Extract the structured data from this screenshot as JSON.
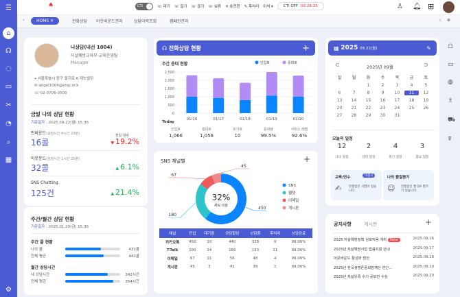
{
  "topbar": {
    "cti_toggle": "CTI",
    "actions": [
      "대기",
      "걸기",
      "끊기",
      "보류",
      "호전환",
      "후처리"
    ],
    "dropdown": "이석",
    "cti_status": "CTI OFF",
    "timer": "00:28:35"
  },
  "tabs": [
    "HOME",
    "전화상담",
    "아웃바운드관리",
    "상담이력조회",
    "캠페인관리"
  ],
  "profile": {
    "name": "나상담(내선 1004)",
    "dept": "자살예방교육부-교육운영팀",
    "role": "Manager",
    "address": "서울특별시 중구 을지로 6 재능빌딩",
    "email": "angel1004@kfsp.or.k",
    "phone": "02-3706-0500"
  },
  "today": {
    "title": "금일 나의 상담 현황",
    "date_label": "기준일자 :",
    "date": "2025.09.22(월) 15:36",
    "compare": "전일 대비",
    "items": [
      {
        "label": "인바운드",
        "sub": "(상담시간 4시간 23분)",
        "value": "16콜",
        "trend": "down",
        "pct": "19.2%"
      },
      {
        "label": "아웃운드",
        "sub": "(상담시간 1시간 25분)",
        "value": "32콜",
        "trend": "up",
        "pct": "6.1%"
      },
      {
        "label": "SNS Chatting",
        "sub": "",
        "value": "125건",
        "trend": "up",
        "pct": "21.4%"
      }
    ]
  },
  "weekly": {
    "title": "주간/월간 상담 현황",
    "date_label": "기준일자 :",
    "date": "2025.01.20(금) 15:36",
    "groups": [
      {
        "title": "주간 콜 현황",
        "rows": [
          {
            "label": "나의 콜",
            "value": "431콜",
            "fill": 0.65
          },
          {
            "label": "전체 평균",
            "value": "442콜",
            "fill": 0.7
          }
        ]
      },
      {
        "title": "월간 상담시간",
        "rows": [
          {
            "label": "내 상담시간",
            "value": "342시간",
            "fill": 0.78
          },
          {
            "label": "전체 평균",
            "value": "354시간",
            "fill": 0.87
          }
        ]
      }
    ]
  },
  "phone": {
    "title": "전화상담 현황",
    "subtitle": "주간 응대 현황",
    "today_label": "Today",
    "stats": [
      {
        "label": "인입호",
        "value": "1,066"
      },
      {
        "label": "응대호",
        "value": "1,056"
      },
      {
        "label": "포기호",
        "value": "10"
      },
      {
        "label": "응대율",
        "value": "99.5%"
      },
      {
        "label": "서비스 레벨",
        "value": "92.6%"
      }
    ]
  },
  "chart_data": [
    {
      "type": "bar",
      "stacked": true,
      "categories": [
        "01/16",
        "01/17",
        "01/18",
        "01/19",
        "01/20"
      ],
      "ylim": [
        0,
        2500
      ],
      "yticks": [
        "0",
        "500",
        "1,000",
        "1,500",
        "2,000",
        "2,500"
      ],
      "legend": "top-right",
      "series": [
        {
          "name": "인입호",
          "color": "#0a84ff",
          "values": [
            1000,
            930,
            800,
            1070,
            1000
          ]
        },
        {
          "name": "응대호",
          "color": "#b28cf5",
          "values": [
            1300,
            1190,
            1050,
            1430,
            1280
          ]
        }
      ]
    },
    {
      "type": "pie",
      "donut": true,
      "title": "SNS 채널별",
      "center_value": "32%",
      "center_label": "채팅 비율",
      "legend": "right",
      "labels": [
        "SNS",
        "웹챗",
        "이메일",
        "게시판"
      ],
      "values": [
        450,
        180,
        67,
        45
      ],
      "colors": [
        "#0a84ff",
        "#2ec4c9",
        "#ee5b5b",
        "#f08a8a"
      ]
    }
  ],
  "sns_table": {
    "headers": [
      "채널",
      "인입",
      "대기중",
      "상담할당",
      "상담중",
      "후처리",
      "상담완료"
    ],
    "rows": [
      [
        "카카오톡",
        "450",
        "10",
        "440",
        "328",
        "9",
        "99.06%"
      ],
      [
        "T-Talk",
        "180",
        "14",
        "166",
        "133",
        "11",
        "99.06%"
      ],
      [
        "이메일",
        "67",
        "11",
        "56",
        "48",
        "4",
        "99.06%"
      ],
      [
        "게시판",
        "45",
        "3",
        "41",
        "39",
        "2",
        "99.06%"
      ]
    ]
  },
  "calendar": {
    "year": "2025",
    "date": "09.22(월)",
    "month_label": "2025년 09월",
    "weekdays": [
      "일",
      "월",
      "화",
      "수",
      "목",
      "금",
      "토"
    ],
    "first_weekday": 2,
    "days": 30,
    "selected": 11
  },
  "schedule": {
    "title": "오늘의 일정",
    "items": [
      {
        "value": "12",
        "label": "나의 일정"
      },
      {
        "value": "2",
        "label": "센터 일정"
      },
      {
        "value": "4",
        "label": "월간 일정"
      },
      {
        "value": "3",
        "label": "중요 일정"
      }
    ]
  },
  "edu": {
    "title": "교육/연수",
    "badge": "미응시",
    "text": "진행중인 시험이 있습니다."
  },
  "qa": {
    "title": "나의 품질평가",
    "text": "진행중인 월 QA 평가가 있습니다."
  },
  "notice": {
    "tabs": [
      "공지사항",
      "게시판"
    ],
    "new_badge": "New",
    "items": [
      {
        "title": "2025 자살예방정책 심포지움 개최",
        "date": "2025.09.16",
        "new": true
      },
      {
        "title": "2025년 자살예방사업 법률지원 안내",
        "date": "2025.09.17"
      },
      {
        "title": "아웃바운드 활성화 방안",
        "date": "2025.09.18"
      },
      {
        "title": "2025년 한국생명존중희망재단 연간...",
        "date": "2025.09.19"
      },
      {
        "title": "2025년 자살유족 수기 공모전 수상",
        "date": "2025.09.20"
      }
    ]
  }
}
